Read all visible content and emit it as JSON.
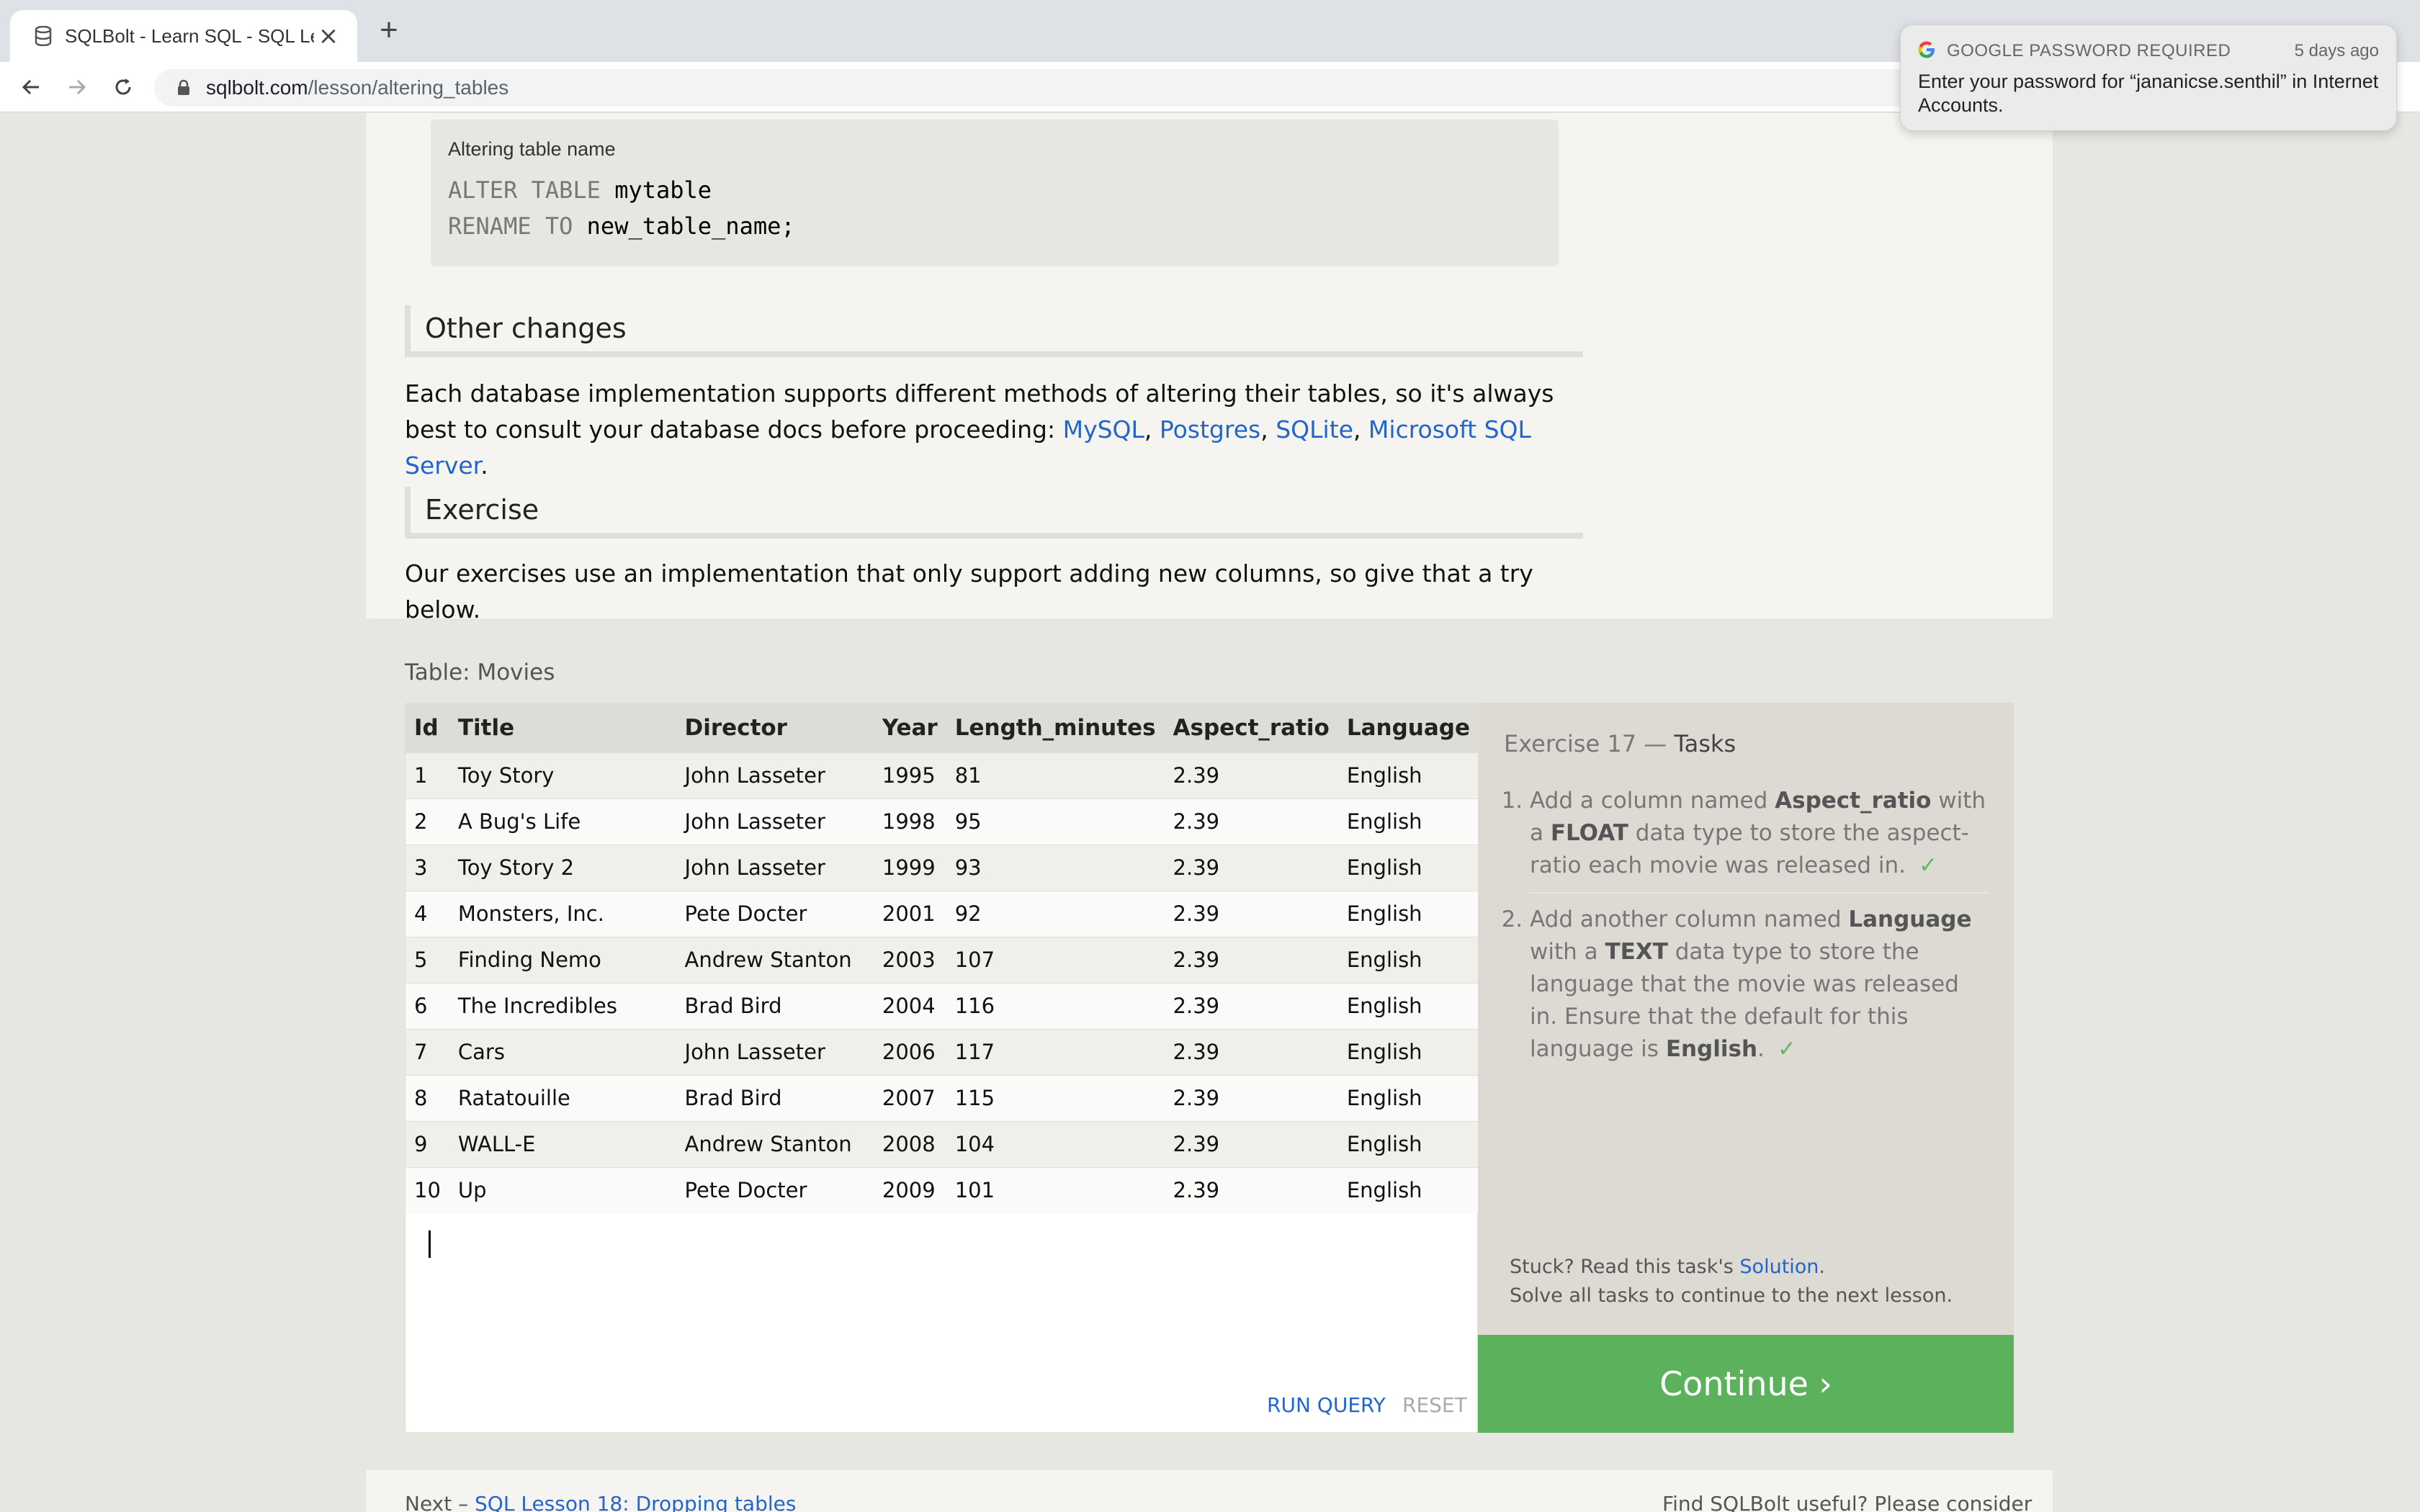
{
  "browser": {
    "tab_title": "SQLBolt - Learn SQL - SQL Les",
    "url_host": "sqlbolt.com",
    "url_path": "/lesson/altering_tables"
  },
  "notification": {
    "title": "GOOGLE PASSWORD REQUIRED",
    "time": "5 days ago",
    "body": "Enter your password for “jananicse.senthil” in Internet Accounts."
  },
  "code_example": {
    "caption": "Altering table name",
    "line1_kw": "ALTER TABLE",
    "line1_rest": " mytable",
    "line2_kw": "RENAME TO",
    "line2_rest": " new_table_name;"
  },
  "other_changes": {
    "heading": "Other changes",
    "text": "Each database implementation supports different methods of altering their tables, so it's always best to consult your database docs before proceeding: ",
    "links": [
      "MySQL",
      "Postgres",
      "SQLite",
      "Microsoft SQL Server"
    ]
  },
  "exercise": {
    "heading": "Exercise",
    "text": "Our exercises use an implementation that only support adding new columns, so give that a try below."
  },
  "table": {
    "caption": "Table: Movies",
    "columns": [
      "Id",
      "Title",
      "Director",
      "Year",
      "Length_minutes",
      "Aspect_ratio",
      "Language"
    ],
    "rows": [
      [
        "1",
        "Toy Story",
        "John Lasseter",
        "1995",
        "81",
        "2.39",
        "English"
      ],
      [
        "2",
        "A Bug's Life",
        "John Lasseter",
        "1998",
        "95",
        "2.39",
        "English"
      ],
      [
        "3",
        "Toy Story 2",
        "John Lasseter",
        "1999",
        "93",
        "2.39",
        "English"
      ],
      [
        "4",
        "Monsters, Inc.",
        "Pete Docter",
        "2001",
        "92",
        "2.39",
        "English"
      ],
      [
        "5",
        "Finding Nemo",
        "Andrew Stanton",
        "2003",
        "107",
        "2.39",
        "English"
      ],
      [
        "6",
        "The Incredibles",
        "Brad Bird",
        "2004",
        "116",
        "2.39",
        "English"
      ],
      [
        "7",
        "Cars",
        "John Lasseter",
        "2006",
        "117",
        "2.39",
        "English"
      ],
      [
        "8",
        "Ratatouille",
        "Brad Bird",
        "2007",
        "115",
        "2.39",
        "English"
      ],
      [
        "9",
        "WALL-E",
        "Andrew Stanton",
        "2008",
        "104",
        "2.39",
        "English"
      ],
      [
        "10",
        "Up",
        "Pete Docter",
        "2009",
        "101",
        "2.39",
        "English"
      ]
    ]
  },
  "editor": {
    "run_label": "RUN QUERY",
    "reset_label": "RESET"
  },
  "tasks": {
    "title_prefix": "Exercise 17 —",
    "title_suffix": "Tasks",
    "items": [
      {
        "a": "Add a column named ",
        "b1": "Aspect_ratio",
        "c": " with a ",
        "b2": "FLOAT",
        "d": " data type to store the aspect-ratio each movie was released in.",
        "check": "✓"
      },
      {
        "a": "Add another column named ",
        "b1": "Language",
        "c": " with a ",
        "b2": "TEXT",
        "d": " data type to store the language that the movie was released in. Ensure that the default for this language is ",
        "b3": "English",
        "e": ".",
        "check": "✓"
      }
    ],
    "stuck_text": "Stuck? Read this task's ",
    "stuck_link": "Solution",
    "stuck_end": ".",
    "solve_text": "Solve all tasks to continue to the next lesson.",
    "continue_label": "Continue ›"
  },
  "footer": {
    "next_prefix": "Next – ",
    "next_link": "SQL Lesson 18: Dropping tables",
    "find_text": "Find SQLBolt useful? Please consider"
  },
  "colors": {
    "accent_link": "#2266cc",
    "continue_green": "#5cb25c",
    "check_green": "#5cb85c"
  }
}
